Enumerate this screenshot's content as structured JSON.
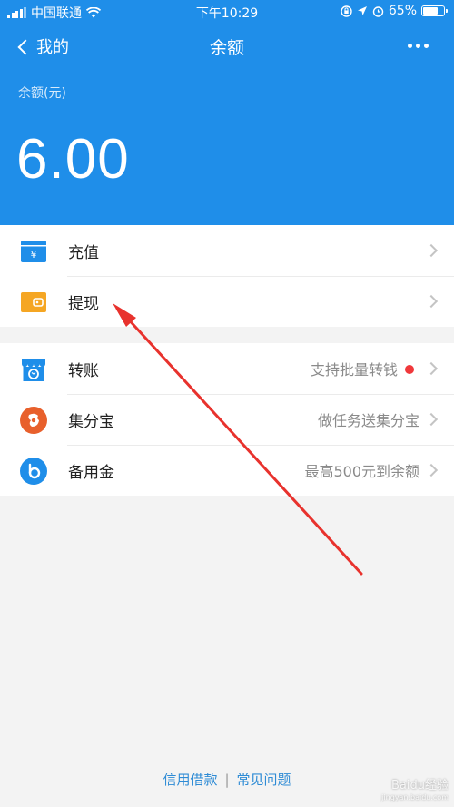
{
  "status_bar": {
    "carrier": "中国联通",
    "time": "下午10:29",
    "battery": "65%"
  },
  "nav": {
    "back_label": "我的",
    "title": "余额"
  },
  "balance": {
    "label": "余额(元)",
    "value": "6.00"
  },
  "group1": [
    {
      "label": "充值",
      "icon": "recharge-icon"
    },
    {
      "label": "提现",
      "icon": "withdraw-icon"
    }
  ],
  "group2": [
    {
      "label": "转账",
      "hint": "支持批量转钱",
      "icon": "transfer-icon",
      "has_dot": true
    },
    {
      "label": "集分宝",
      "hint": "做任务送集分宝",
      "icon": "jifenbao-icon"
    },
    {
      "label": "备用金",
      "hint": "最高500元到余额",
      "icon": "beiyongjin-icon"
    }
  ],
  "footer": {
    "link1": "信用借款",
    "link2": "常见问题",
    "separator": "|"
  },
  "watermark": {
    "text": "Baidu经验",
    "url_text": "jingyan.baidu.com"
  },
  "colors": {
    "primary": "#1f8ee9",
    "accent_dot": "#f0383b",
    "annotation_arrow": "#e8322d"
  }
}
